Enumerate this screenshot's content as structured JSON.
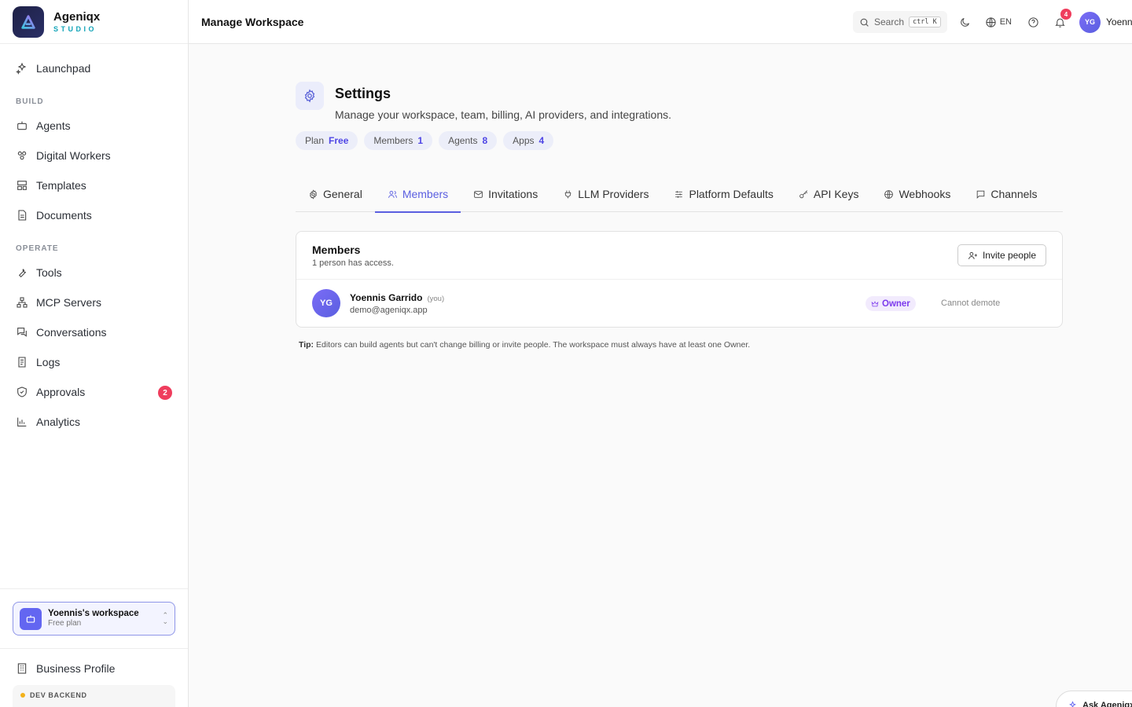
{
  "brand": {
    "name": "Ageniqx",
    "sub": "STUDIO"
  },
  "sidebar": {
    "launchpad": "Launchpad",
    "build_section": "BUILD",
    "build_items": [
      "Agents",
      "Digital Workers",
      "Templates",
      "Documents"
    ],
    "operate_section": "OPERATE",
    "operate_items": [
      "Tools",
      "MCP Servers",
      "Conversations",
      "Logs",
      "Approvals",
      "Analytics"
    ],
    "approvals_badge": "2",
    "workspace": {
      "name": "Yoennis's workspace",
      "plan": "Free plan"
    },
    "business_profile": "Business Profile",
    "dev_backend": "DEV BACKEND"
  },
  "topbar": {
    "title": "Manage Workspace",
    "search_label": "Search",
    "search_kbd": "ctrl K",
    "lang": "EN",
    "notif_count": "4",
    "user_initials": "YG",
    "user_name": "Yoennis"
  },
  "settings": {
    "title": "Settings",
    "description": "Manage your workspace, team, billing, AI providers, and integrations.",
    "pills": [
      {
        "label": "Plan",
        "value": "Free"
      },
      {
        "label": "Members",
        "value": "1"
      },
      {
        "label": "Agents",
        "value": "8"
      },
      {
        "label": "Apps",
        "value": "4"
      }
    ],
    "tabs": [
      "General",
      "Members",
      "Invitations",
      "LLM Providers",
      "Platform Defaults",
      "API Keys",
      "Webhooks",
      "Channels"
    ],
    "active_tab": "Members"
  },
  "members_card": {
    "title": "Members",
    "subtitle": "1 person has access.",
    "invite_label": "Invite people",
    "member": {
      "initials": "YG",
      "name": "Yoennis Garrido",
      "you": "(you)",
      "email": "demo@ageniqx.app",
      "role": "Owner",
      "action": "Cannot demote"
    }
  },
  "tip": {
    "label": "Tip:",
    "text": " Editors can build agents but can't change billing or invite people. The workspace must always have at least one Owner."
  },
  "ask_button": "Ask Ageniqx",
  "colors": {
    "accent": "#5a5ee0",
    "badge": "#ef3d5d",
    "owner": "#7c3aed",
    "brand_sub": "#12a4b8"
  }
}
